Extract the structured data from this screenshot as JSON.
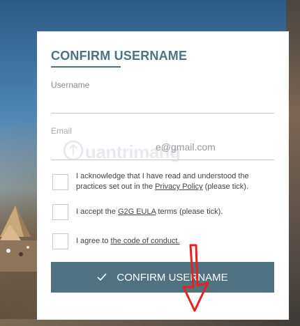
{
  "form": {
    "title": "CONFIRM USERNAME",
    "username_label": "Username",
    "username_value": "",
    "email_label": "Email",
    "email_value": "e@gmail.com",
    "watermark_text": "uantrimang",
    "check1_pre": "I acknowledge that I have read and understood the practices set out in the ",
    "check1_link": "Privacy Policy",
    "check1_post": " (please tick).",
    "check2_pre": "I accept the ",
    "check2_link": "G2G EULA",
    "check2_post": " terms (please tick).",
    "check3_pre": "I agree to ",
    "check3_link": "the code of conduct.",
    "submit_label": "CONFIRM USERNAME",
    "submit_icon": "checkmark-icon"
  },
  "colors": {
    "accent": "#4d7382",
    "button": "#4f7280",
    "arrow": "#e8201e"
  }
}
